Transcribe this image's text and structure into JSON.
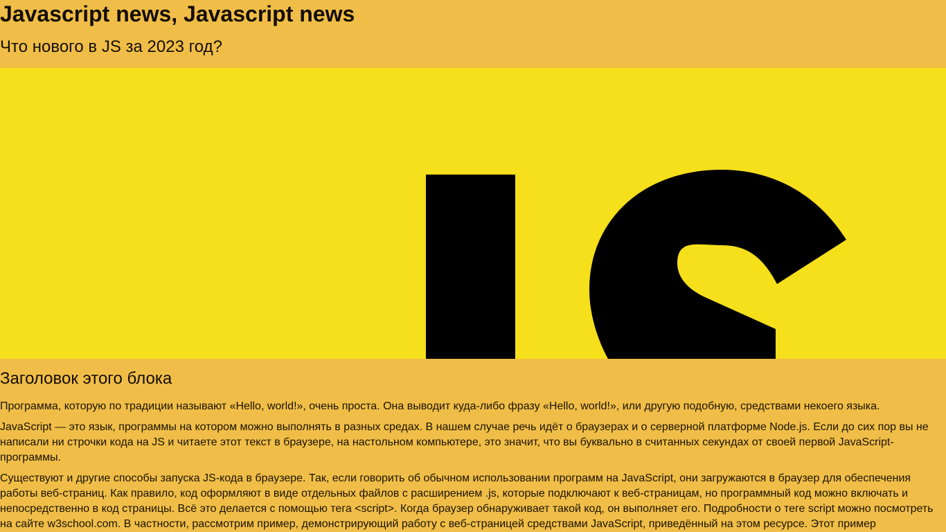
{
  "header": {
    "title": "Javascript news, Javascript news",
    "subtitle": "Что нового в JS за 2023 год?"
  },
  "hero": {
    "image_text": "JS",
    "background_color": "#f6df1b",
    "text_color": "#000000"
  },
  "article": {
    "heading": "Заголовок этого блока",
    "paragraphs": [
      "Программа, которую по традиции называют «Hello, world!», очень проста. Она выводит куда-либо фразу «Hello, world!», или другую подобную, средствами некоего языка.",
      "JavaScript — это язык, программы на котором можно выполнять в разных средах. В нашем случае речь идёт о браузерах и о серверной платформе Node.js. Если до сих пор вы не написали ни строчки кода на JS и читаете этот текст в браузере, на настольном компьютере, это значит, что вы буквально в считанных секундах от своей первой JavaScript-программы.",
      "Существуют и другие способы запуска JS-кода в браузере. Так, если говорить об обычном использовании программ на JavaScript, они загружаются в браузер для обеспечения работы веб-страниц. Как правило, код оформляют в виде отдельных файлов с расширением .js, которые подключают к веб-страницам, но программный код можно включать и непосредственно в код страницы. Всё это делается с помощью тега <script>. Когда браузер обнаруживает такой код, он выполняет его. Подробности о теге script можно посмотреть на сайте w3school.com. В частности, рассмотрим пример, демонстрирующий работу с веб-страницей средствами JavaScript, приведённый на этом ресурсе. Этот пример"
    ]
  },
  "colors": {
    "page_background": "#f0be48",
    "text": "#1b1204"
  }
}
